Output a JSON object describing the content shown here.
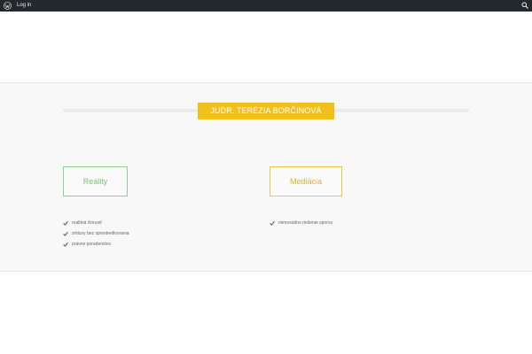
{
  "adminbar": {
    "logo_icon": "wordpress-icon",
    "login_label": "Log in",
    "search_icon": "search-icon",
    "background": "#23282d"
  },
  "section": {
    "title": "JUDR. TERÉZIA BORČINOVÁ",
    "accent_color": "#f2c01a"
  },
  "services": [
    {
      "label": "Reality",
      "color": "#79c279",
      "items": [
        "realitná činnosť",
        "zmluvy bez sprostredkovania",
        "právne poradenstvo"
      ]
    },
    {
      "label": "Mediácia",
      "color": "#e9b322",
      "items": [
        "mimosúdne riešenie sporov"
      ]
    }
  ],
  "list_icon": "check-icon"
}
